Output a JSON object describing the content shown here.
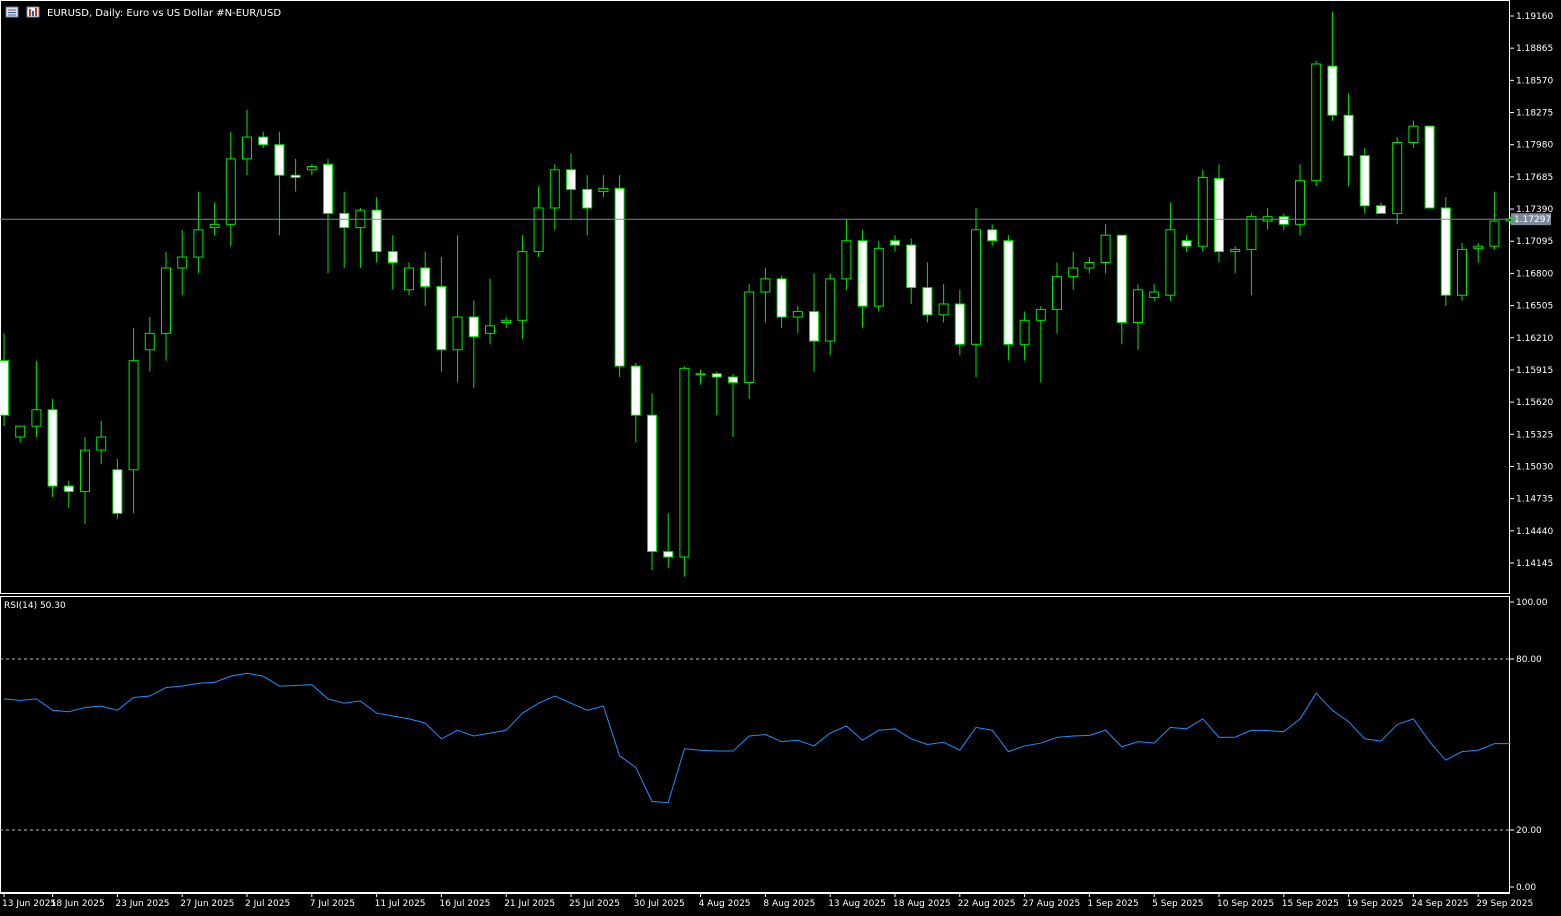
{
  "header": {
    "title": "EURUSD, Daily:  Euro vs US Dollar #N-EUR/USD",
    "icon_left": "list-icon",
    "icon_right": "chart-icon"
  },
  "rsi_panel": {
    "label": "RSI(14) 50.30"
  },
  "colors": {
    "background": "#000000",
    "bull": "#000000",
    "bear": "#FFFFFF",
    "outline": "#00E600",
    "rsi_line": "#1E90FF",
    "grid_text": "#FFFFFF",
    "current_price_line": "#7A8A99",
    "current_price_badge": "#7A8A99"
  },
  "current_price_label": "1.17297",
  "chart_data": [
    {
      "type": "candlestick",
      "symbol": "EURUSD",
      "timeframe": "Daily",
      "ylim": [
        1.1396,
        1.1925
      ],
      "y_ticks": [
        "1.19160",
        "1.18865",
        "1.18570",
        "1.18275",
        "1.17980",
        "1.17685",
        "1.17390",
        "1.17095",
        "1.16800",
        "1.16505",
        "1.16210",
        "1.15915",
        "1.15620",
        "1.15325",
        "1.15030",
        "1.14735",
        "1.14440",
        "1.14145"
      ],
      "current_price": 1.17297,
      "x_labels": [
        {
          "i": 0,
          "label": "13 Jun 2025"
        },
        {
          "i": 3,
          "label": "18 Jun 2025"
        },
        {
          "i": 7,
          "label": "23 Jun 2025"
        },
        {
          "i": 11,
          "label": "27 Jun 2025"
        },
        {
          "i": 15,
          "label": "2 Jul 2025"
        },
        {
          "i": 19,
          "label": "7 Jul 2025"
        },
        {
          "i": 23,
          "label": "11 Jul 2025"
        },
        {
          "i": 27,
          "label": "16 Jul 2025"
        },
        {
          "i": 31,
          "label": "21 Jul 2025"
        },
        {
          "i": 35,
          "label": "25 Jul 2025"
        },
        {
          "i": 39,
          "label": "30 Jul 2025"
        },
        {
          "i": 43,
          "label": "4 Aug 2025"
        },
        {
          "i": 47,
          "label": "8 Aug 2025"
        },
        {
          "i": 51,
          "label": "13 Aug 2025"
        },
        {
          "i": 55,
          "label": "18 Aug 2025"
        },
        {
          "i": 59,
          "label": "22 Aug 2025"
        },
        {
          "i": 63,
          "label": "27 Aug 2025"
        },
        {
          "i": 67,
          "label": "1 Sep 2025"
        },
        {
          "i": 71,
          "label": "5 Sep 2025"
        },
        {
          "i": 75,
          "label": "10 Sep 2025"
        },
        {
          "i": 79,
          "label": "15 Sep 2025"
        },
        {
          "i": 83,
          "label": "19 Sep 2025"
        },
        {
          "i": 87,
          "label": "24 Sep 2025"
        },
        {
          "i": 91,
          "label": "29 Sep 2025"
        }
      ],
      "candles": [
        {
          "o": 1.16,
          "h": 1.1625,
          "l": 1.154,
          "c": 1.155
        },
        {
          "o": 1.153,
          "h": 1.154,
          "l": 1.1525,
          "c": 1.154
        },
        {
          "o": 1.154,
          "h": 1.16,
          "l": 1.153,
          "c": 1.1555
        },
        {
          "o": 1.1555,
          "h": 1.1565,
          "l": 1.1475,
          "c": 1.1485
        },
        {
          "o": 1.1485,
          "h": 1.149,
          "l": 1.1465,
          "c": 1.148
        },
        {
          "o": 1.148,
          "h": 1.153,
          "l": 1.145,
          "c": 1.1518
        },
        {
          "o": 1.1518,
          "h": 1.1545,
          "l": 1.1505,
          "c": 1.153
        },
        {
          "o": 1.15,
          "h": 1.151,
          "l": 1.1455,
          "c": 1.146
        },
        {
          "o": 1.15,
          "h": 1.163,
          "l": 1.146,
          "c": 1.16
        },
        {
          "o": 1.161,
          "h": 1.164,
          "l": 1.159,
          "c": 1.1625
        },
        {
          "o": 1.1625,
          "h": 1.17,
          "l": 1.16,
          "c": 1.1685
        },
        {
          "o": 1.1685,
          "h": 1.172,
          "l": 1.166,
          "c": 1.1695
        },
        {
          "o": 1.1695,
          "h": 1.1755,
          "l": 1.168,
          "c": 1.172
        },
        {
          "o": 1.1722,
          "h": 1.1745,
          "l": 1.1715,
          "c": 1.1725
        },
        {
          "o": 1.1725,
          "h": 1.181,
          "l": 1.1705,
          "c": 1.1785
        },
        {
          "o": 1.1785,
          "h": 1.183,
          "l": 1.177,
          "c": 1.1805
        },
        {
          "o": 1.1805,
          "h": 1.181,
          "l": 1.1795,
          "c": 1.1798
        },
        {
          "o": 1.1798,
          "h": 1.181,
          "l": 1.1715,
          "c": 1.177
        },
        {
          "o": 1.177,
          "h": 1.1785,
          "l": 1.1755,
          "c": 1.1768
        },
        {
          "o": 1.1775,
          "h": 1.178,
          "l": 1.177,
          "c": 1.1778
        },
        {
          "o": 1.178,
          "h": 1.1785,
          "l": 1.168,
          "c": 1.1735
        },
        {
          "o": 1.1735,
          "h": 1.1755,
          "l": 1.1685,
          "c": 1.1722
        },
        {
          "o": 1.1722,
          "h": 1.174,
          "l": 1.1685,
          "c": 1.1738
        },
        {
          "o": 1.1738,
          "h": 1.175,
          "l": 1.169,
          "c": 1.17
        },
        {
          "o": 1.17,
          "h": 1.1715,
          "l": 1.1665,
          "c": 1.169
        },
        {
          "o": 1.1665,
          "h": 1.169,
          "l": 1.166,
          "c": 1.1685
        },
        {
          "o": 1.1685,
          "h": 1.17,
          "l": 1.165,
          "c": 1.1668
        },
        {
          "o": 1.1668,
          "h": 1.1695,
          "l": 1.159,
          "c": 1.161
        },
        {
          "o": 1.161,
          "h": 1.1715,
          "l": 1.158,
          "c": 1.164
        },
        {
          "o": 1.164,
          "h": 1.1655,
          "l": 1.1575,
          "c": 1.1622
        },
        {
          "o": 1.1625,
          "h": 1.1675,
          "l": 1.1615,
          "c": 1.1632
        },
        {
          "o": 1.1635,
          "h": 1.164,
          "l": 1.163,
          "c": 1.1637
        },
        {
          "o": 1.1637,
          "h": 1.1715,
          "l": 1.162,
          "c": 1.17
        },
        {
          "o": 1.17,
          "h": 1.176,
          "l": 1.1695,
          "c": 1.174
        },
        {
          "o": 1.174,
          "h": 1.178,
          "l": 1.172,
          "c": 1.1775
        },
        {
          "o": 1.1775,
          "h": 1.179,
          "l": 1.173,
          "c": 1.1757
        },
        {
          "o": 1.1757,
          "h": 1.177,
          "l": 1.1715,
          "c": 1.174
        },
        {
          "o": 1.1755,
          "h": 1.177,
          "l": 1.175,
          "c": 1.1758
        },
        {
          "o": 1.1758,
          "h": 1.177,
          "l": 1.1585,
          "c": 1.1595
        },
        {
          "o": 1.1595,
          "h": 1.1598,
          "l": 1.1525,
          "c": 1.155
        },
        {
          "o": 1.155,
          "h": 1.157,
          "l": 1.1408,
          "c": 1.1425
        },
        {
          "o": 1.1425,
          "h": 1.146,
          "l": 1.141,
          "c": 1.142
        },
        {
          "o": 1.142,
          "h": 1.1595,
          "l": 1.1402,
          "c": 1.1593
        },
        {
          "o": 1.1587,
          "h": 1.1592,
          "l": 1.1578,
          "c": 1.1588
        },
        {
          "o": 1.1588,
          "h": 1.159,
          "l": 1.155,
          "c": 1.1585
        },
        {
          "o": 1.1585,
          "h": 1.1588,
          "l": 1.153,
          "c": 1.158
        },
        {
          "o": 1.158,
          "h": 1.167,
          "l": 1.1565,
          "c": 1.1663
        },
        {
          "o": 1.1663,
          "h": 1.1685,
          "l": 1.1635,
          "c": 1.1675
        },
        {
          "o": 1.1675,
          "h": 1.1678,
          "l": 1.163,
          "c": 1.164
        },
        {
          "o": 1.164,
          "h": 1.165,
          "l": 1.1625,
          "c": 1.1645
        },
        {
          "o": 1.1645,
          "h": 1.168,
          "l": 1.159,
          "c": 1.1618
        },
        {
          "o": 1.1618,
          "h": 1.168,
          "l": 1.1605,
          "c": 1.1675
        },
        {
          "o": 1.1675,
          "h": 1.173,
          "l": 1.1665,
          "c": 1.171
        },
        {
          "o": 1.171,
          "h": 1.172,
          "l": 1.163,
          "c": 1.165
        },
        {
          "o": 1.165,
          "h": 1.171,
          "l": 1.1645,
          "c": 1.1703
        },
        {
          "o": 1.171,
          "h": 1.1715,
          "l": 1.17,
          "c": 1.1706
        },
        {
          "o": 1.1706,
          "h": 1.1712,
          "l": 1.1652,
          "c": 1.1667
        },
        {
          "o": 1.1667,
          "h": 1.169,
          "l": 1.1635,
          "c": 1.1642
        },
        {
          "o": 1.1642,
          "h": 1.167,
          "l": 1.1635,
          "c": 1.1652
        },
        {
          "o": 1.1652,
          "h": 1.1665,
          "l": 1.1605,
          "c": 1.1615
        },
        {
          "o": 1.1615,
          "h": 1.174,
          "l": 1.1585,
          "c": 1.172
        },
        {
          "o": 1.172,
          "h": 1.1725,
          "l": 1.1705,
          "c": 1.171
        },
        {
          "o": 1.171,
          "h": 1.1715,
          "l": 1.16,
          "c": 1.1615
        },
        {
          "o": 1.1615,
          "h": 1.1645,
          "l": 1.16,
          "c": 1.1637
        },
        {
          "o": 1.1637,
          "h": 1.165,
          "l": 1.158,
          "c": 1.1647
        },
        {
          "o": 1.1647,
          "h": 1.169,
          "l": 1.1625,
          "c": 1.1677
        },
        {
          "o": 1.1677,
          "h": 1.17,
          "l": 1.1665,
          "c": 1.1685
        },
        {
          "o": 1.1685,
          "h": 1.1695,
          "l": 1.168,
          "c": 1.169
        },
        {
          "o": 1.169,
          "h": 1.1725,
          "l": 1.168,
          "c": 1.1715
        },
        {
          "o": 1.1715,
          "h": 1.1715,
          "l": 1.1615,
          "c": 1.1635
        },
        {
          "o": 1.1635,
          "h": 1.167,
          "l": 1.161,
          "c": 1.1665
        },
        {
          "o": 1.1658,
          "h": 1.167,
          "l": 1.1655,
          "c": 1.1663
        },
        {
          "o": 1.166,
          "h": 1.1745,
          "l": 1.1655,
          "c": 1.172
        },
        {
          "o": 1.171,
          "h": 1.1715,
          "l": 1.17,
          "c": 1.1705
        },
        {
          "o": 1.1705,
          "h": 1.1775,
          "l": 1.17,
          "c": 1.1768
        },
        {
          "o": 1.1767,
          "h": 1.178,
          "l": 1.169,
          "c": 1.17
        },
        {
          "o": 1.17,
          "h": 1.1705,
          "l": 1.168,
          "c": 1.1702
        },
        {
          "o": 1.1702,
          "h": 1.1735,
          "l": 1.166,
          "c": 1.1732
        },
        {
          "o": 1.1728,
          "h": 1.174,
          "l": 1.172,
          "c": 1.1732
        },
        {
          "o": 1.1732,
          "h": 1.1735,
          "l": 1.172,
          "c": 1.1725
        },
        {
          "o": 1.1725,
          "h": 1.178,
          "l": 1.1715,
          "c": 1.1765
        },
        {
          "o": 1.1765,
          "h": 1.1875,
          "l": 1.176,
          "c": 1.1872
        },
        {
          "o": 1.187,
          "h": 1.192,
          "l": 1.182,
          "c": 1.1825
        },
        {
          "o": 1.1825,
          "h": 1.1845,
          "l": 1.176,
          "c": 1.1788
        },
        {
          "o": 1.1788,
          "h": 1.1795,
          "l": 1.1735,
          "c": 1.1742
        },
        {
          "o": 1.1742,
          "h": 1.1745,
          "l": 1.1735,
          "c": 1.1735
        },
        {
          "o": 1.1735,
          "h": 1.1805,
          "l": 1.1725,
          "c": 1.18
        },
        {
          "o": 1.18,
          "h": 1.182,
          "l": 1.1795,
          "c": 1.1815
        },
        {
          "o": 1.1815,
          "h": 1.1815,
          "l": 1.174,
          "c": 1.174
        },
        {
          "o": 1.174,
          "h": 1.175,
          "l": 1.165,
          "c": 1.166
        },
        {
          "o": 1.166,
          "h": 1.1708,
          "l": 1.1655,
          "c": 1.1702
        },
        {
          "o": 1.1703,
          "h": 1.1708,
          "l": 1.169,
          "c": 1.1705
        },
        {
          "o": 1.1705,
          "h": 1.1755,
          "l": 1.1702,
          "c": 1.1728
        },
        {
          "o": 1.1728,
          "h": 1.1732,
          "l": 1.1725,
          "c": 1.173
        }
      ]
    },
    {
      "type": "line",
      "name": "RSI(14)",
      "ylim": [
        0,
        100
      ],
      "y_ticks": [
        "100.00",
        "80.00",
        "20.00",
        "0.00"
      ],
      "levels": [
        80,
        20
      ],
      "values": [
        66,
        65.5,
        66,
        62,
        61.5,
        63,
        63.5,
        62,
        66.5,
        67,
        70,
        70.5,
        71.5,
        71.8,
        74,
        75,
        74,
        70.5,
        70.7,
        71,
        66,
        64.5,
        65.3,
        61,
        60,
        59,
        57.5,
        52,
        55,
        53,
        54,
        55,
        61,
        64.5,
        67,
        64.5,
        62,
        63.5,
        46,
        42,
        30,
        29.6,
        48.5,
        48,
        47.7,
        47.7,
        53,
        53.5,
        51,
        51.5,
        49.5,
        54,
        56.5,
        51.5,
        55,
        55.5,
        52,
        50,
        50.8,
        48,
        56,
        55,
        47.5,
        49.5,
        50.5,
        52.5,
        53,
        53.2,
        55,
        49.2,
        51,
        50.5,
        56,
        55.5,
        59,
        52.5,
        52.6,
        55,
        54.9,
        54.5,
        59,
        68,
        62,
        58,
        52,
        51.2,
        57,
        59,
        51,
        44.5,
        47.5,
        48,
        50.3,
        50.3
      ]
    }
  ]
}
